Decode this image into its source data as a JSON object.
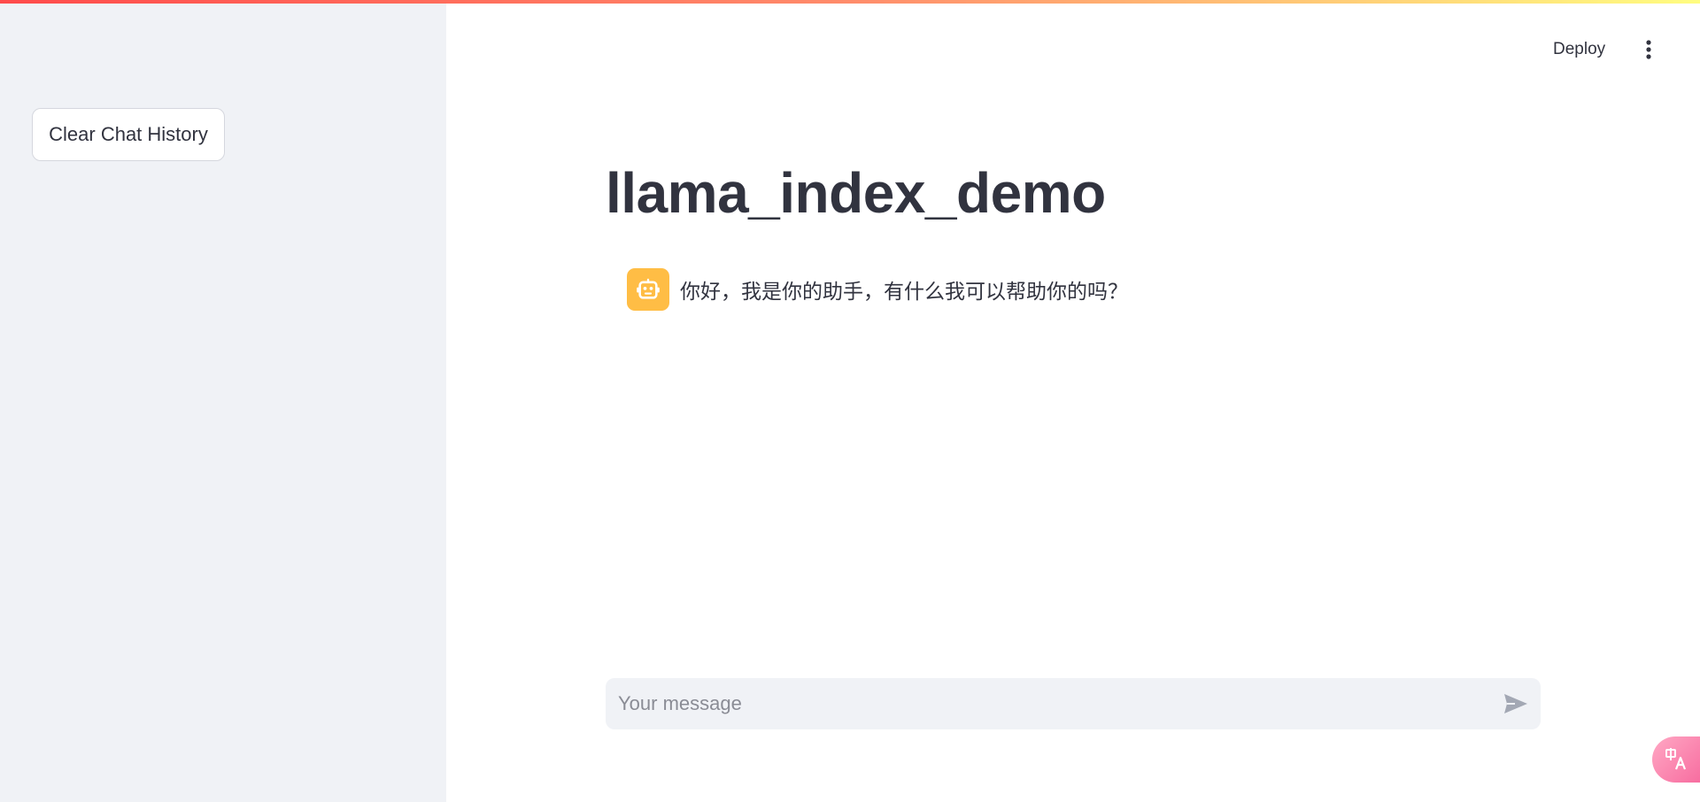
{
  "sidebar": {
    "clear_button_label": "Clear Chat History"
  },
  "header": {
    "deploy_label": "Deploy",
    "menu_icon": "more-vert-icon"
  },
  "main": {
    "title": "llama_index_demo",
    "messages": [
      {
        "role": "assistant",
        "avatar_icon": "robot-icon",
        "text": "你好，我是你的助手，有什么我可以帮助你的吗？"
      }
    ]
  },
  "chat_input": {
    "placeholder": "Your message",
    "value": "",
    "send_icon": "send-icon"
  },
  "translate_widget": {
    "icon": "translate-icon"
  },
  "colors": {
    "sidebar_bg": "#f0f2f6",
    "avatar_bg": "#ffbd45",
    "text": "#31333f",
    "accent_gradient_start": "#ff4b4b",
    "accent_gradient_end": "#fffd80",
    "translate_bg": "#f76a9e"
  }
}
